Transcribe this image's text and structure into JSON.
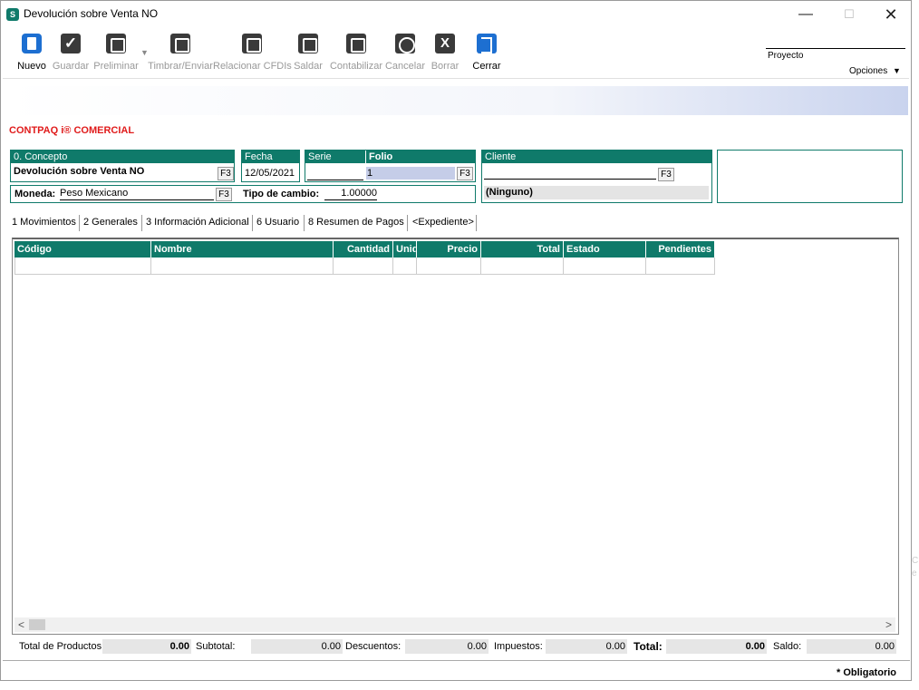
{
  "window": {
    "title": "Devolución sobre Venta NO",
    "icon_letter": "S",
    "accent": "#0f7a6a"
  },
  "toolbar": {
    "buttons": [
      {
        "label": "Nuevo",
        "icon": "new-document-icon"
      },
      {
        "label": "Guardar",
        "icon": "checkmark-icon"
      },
      {
        "label": "Preliminar",
        "icon": "preview-icon"
      },
      {
        "label": "Timbrar/Enviar",
        "icon": "stamp-send-icon"
      },
      {
        "label": "Relacionar CFDIs",
        "icon": "relate-documents-icon"
      },
      {
        "label": "Saldar",
        "icon": "settle-icon"
      },
      {
        "label": "Contabilizar",
        "icon": "accounting-icon"
      },
      {
        "label": "Cancelar",
        "icon": "cancel-icon"
      },
      {
        "label": "Borrar",
        "icon": "delete-x-icon"
      },
      {
        "label": "Cerrar",
        "icon": "exit-door-icon"
      }
    ],
    "proyecto_label": "Proyecto",
    "opciones_label": "Opciones"
  },
  "brand": "CONTPAQ i® COMERCIAL",
  "header": {
    "concepto_label": "0. Concepto",
    "concepto_value": "Devolución sobre Venta NO",
    "fecha_label": "Fecha",
    "fecha_value": "12/05/2021",
    "serie_label": "Serie",
    "folio_label": "Folio",
    "folio_value": "1",
    "cliente_label": "Cliente",
    "cliente_name": "(Ninguno)",
    "moneda_label": "Moneda:",
    "moneda_value": "Peso Mexicano",
    "tipo_cambio_label": "Tipo de cambio:",
    "tipo_cambio_value": "1.00000",
    "f3": "F3"
  },
  "tabs": [
    "1 Movimientos",
    "2 Generales",
    "3 Información Adicional",
    "6 Usuario",
    "8 Resumen de Pagos",
    "<Expediente>"
  ],
  "grid": {
    "columns": [
      "Código",
      "Nombre",
      "Cantidad",
      "Unid",
      "Precio",
      "Total",
      "Estado",
      "Pendientes"
    ]
  },
  "totals": {
    "total_productos_label": "Total de Productos:",
    "total_productos_value": "0.00",
    "subtotal_label": "Subtotal:",
    "subtotal_value": "0.00",
    "descuentos_label": "Descuentos:",
    "descuentos_value": "0.00",
    "impuestos_label": "Impuestos:",
    "impuestos_value": "0.00",
    "total_label": "Total:",
    "total_value": "0.00",
    "saldo_label": "Saldo:",
    "saldo_value": "0.00"
  },
  "footer": {
    "obligatorio": "* Obligatorio"
  }
}
